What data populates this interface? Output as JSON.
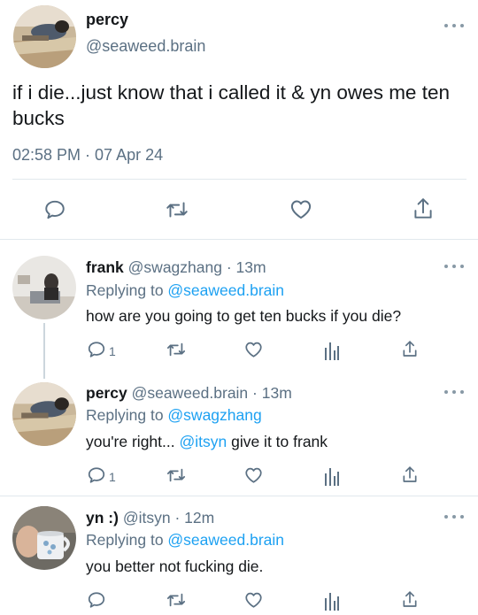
{
  "main_tweet": {
    "name": "percy",
    "handle": "@seaweed.brain",
    "text": "if i die...just know that i called it & yn owes me ten bucks",
    "timestamp": "02:58 PM · 07 Apr 24"
  },
  "replies": [
    {
      "name": "frank",
      "handle": "@swagzhang",
      "age": "13m",
      "replying_prefix": "Replying to ",
      "replying_to": "@seaweed.brain",
      "text": "how are you going to get ten bucks if you die?",
      "reply_count": "1"
    },
    {
      "name": "percy",
      "handle": "@seaweed.brain",
      "age": "13m",
      "replying_prefix": "Replying to ",
      "replying_to": "@swagzhang",
      "text_before": "you're right... ",
      "mention": "@itsyn",
      "text_after": " give it to frank",
      "reply_count": "1"
    },
    {
      "name": "yn :)",
      "handle": "@itsyn",
      "age": "12m",
      "replying_prefix": "Replying to ",
      "replying_to": "@seaweed.brain",
      "text": "you better not fucking die."
    }
  ],
  "separator": " · ",
  "icons": [
    "reply-icon",
    "retweet-icon",
    "like-icon",
    "share-icon",
    "analytics-icon",
    "more-icon"
  ],
  "colors": {
    "link": "#1da1f2",
    "secondary": "#5b7083",
    "divider": "#e1e8ed",
    "icon": "#5b7083"
  }
}
